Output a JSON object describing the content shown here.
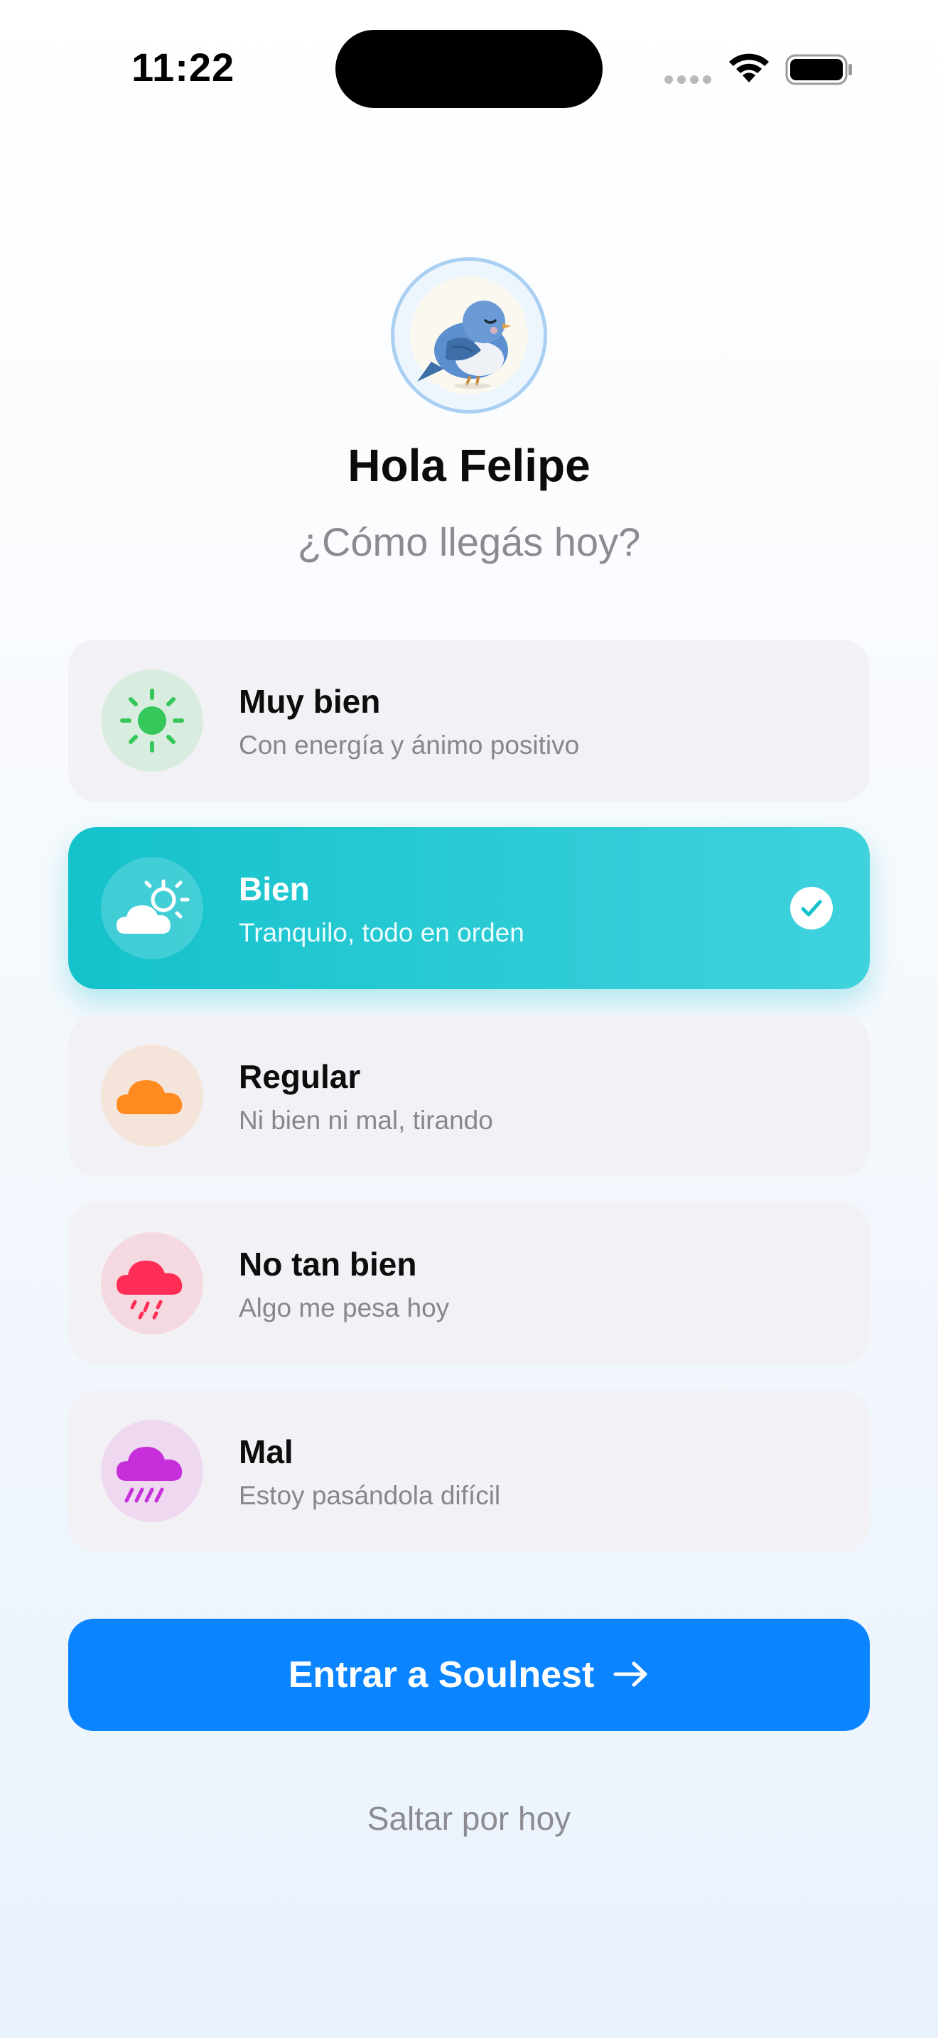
{
  "status_bar": {
    "time": "11:22"
  },
  "header": {
    "avatar": "bird-illustration",
    "greeting": "Hola Felipe",
    "question": "¿Cómo llegás hoy?"
  },
  "moods": [
    {
      "title": "Muy bien",
      "subtitle": "Con energía y ánimo positivo",
      "icon": "sun-icon",
      "color": "#34c759",
      "selected": false
    },
    {
      "title": "Bien",
      "subtitle": "Tranquilo, todo en orden",
      "icon": "partly-cloudy-icon",
      "color": "#ffffff",
      "selected": true
    },
    {
      "title": "Regular",
      "subtitle": "Ni bien ni mal, tirando",
      "icon": "cloud-icon",
      "color": "#ff8a1f",
      "selected": false
    },
    {
      "title": "No tan bien",
      "subtitle": "Algo me pesa hoy",
      "icon": "rain-cloud-icon",
      "color": "#ff2d55",
      "selected": false
    },
    {
      "title": "Mal",
      "subtitle": "Estoy pasándola difícil",
      "icon": "heavy-rain-cloud-icon",
      "color": "#c72fdb",
      "selected": false
    }
  ],
  "actions": {
    "primary_label": "Entrar a Soulnest",
    "primary_icon": "arrow-right-icon",
    "secondary_label": "Saltar por hoy"
  },
  "colors": {
    "accent": "#0a84ff",
    "selected_card": "#14c2cc",
    "card_bg": "#f2f1f6",
    "muted_text": "#8b8b90"
  }
}
